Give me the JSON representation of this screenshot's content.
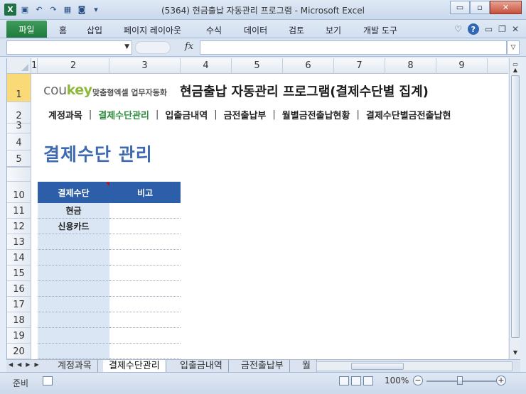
{
  "window": {
    "title": "(5364) 현금출납 자동관리 프로그램 - Microsoft Excel",
    "minimize": "▭",
    "restore": "▫",
    "close": "✕"
  },
  "ribbon": {
    "file": "파일",
    "tabs": [
      "홈",
      "삽입",
      "페이지 레이아웃",
      "수식",
      "데이터",
      "검토",
      "보기",
      "개발 도구"
    ],
    "help": "?"
  },
  "formula_bar": {
    "name_box": "",
    "fx": "fx",
    "formula": ""
  },
  "columns": [
    "1",
    "2",
    "3",
    "4",
    "5",
    "6",
    "7",
    "8",
    "9"
  ],
  "rows": [
    "1",
    "2",
    "3",
    "4",
    "5",
    "10",
    "11",
    "12",
    "13",
    "14",
    "15",
    "16",
    "17",
    "18",
    "19",
    "20"
  ],
  "sheet": {
    "logo_cou": "cou",
    "logo_key": "key",
    "logo_sub": "맞춤형엑셀 업무자동화",
    "main_title": "현금출납 자동관리 프로그램(결제수단별 집계)",
    "nav": [
      "계정과목",
      "결제수단관리",
      "입출금내역",
      "금전출납부",
      "월별금전출납현황",
      "결제수단별금전출납현"
    ],
    "nav_sep": "|",
    "page_title": "결제수단 관리",
    "table_headers": [
      "결제수단",
      "비고"
    ],
    "table_rows": [
      "현금",
      "신용카드",
      "",
      "",
      "",
      "",
      "",
      "",
      "",
      ""
    ]
  },
  "sheet_tabs": [
    "계정과목",
    "결제수단관리",
    "입출금내역",
    "금전출납부",
    "월"
  ],
  "status": {
    "ready": "준비",
    "zoom": "100%",
    "minus": "−",
    "plus": "+"
  }
}
